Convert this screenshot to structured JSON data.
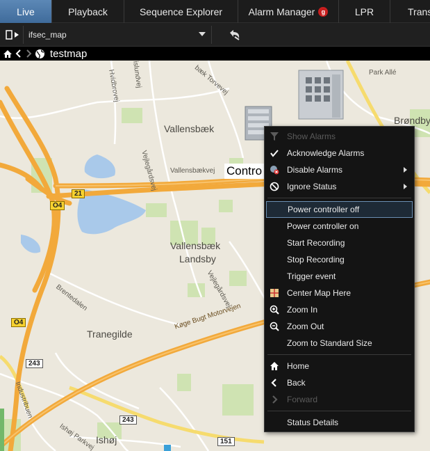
{
  "tabs": [
    {
      "label": "Live",
      "active": true
    },
    {
      "label": "Playback"
    },
    {
      "label": "Sequence Explorer"
    },
    {
      "label": "Alarm Manager",
      "badge": "g"
    },
    {
      "label": "LPR"
    },
    {
      "label": "Transa"
    }
  ],
  "toolbar": {
    "map_name": "ifsec_map"
  },
  "breadcrumb": {
    "title": "testmap"
  },
  "map": {
    "device_label": "Contro",
    "labels": {
      "park_alle": "Park Allé",
      "brondby": "Brøndby",
      "vallensbaek": "Vallensbæk",
      "vallensbaek_landsby_1": "Vallensbæk",
      "vallensbaek_landsby_2": "Landsby",
      "tranegilde": "Tranegilde",
      "ishoj": "Ishøj",
      "vallensbaekvej": "Vallensbækvej",
      "vejlegardsvej": "Vejlegårdsvej",
      "vejlegardsvej_2": "Vejlegårdsvej",
      "hvidbrovej": "Hvidbrovej",
      "islundvej": "islundvej",
      "torvevej": "bæk Torvevej",
      "brentedalen": "Brentedalen",
      "koge_bugt": "Køge Bugt Motorvejen",
      "industribuen": "Industribuen",
      "ishoj_parkvej": "Ishøj Parkvej"
    },
    "shields": {
      "r21": "21",
      "o4a": "O4",
      "o4b": "O4",
      "r243a": "243",
      "r243b": "243",
      "r151": "151"
    }
  },
  "context_menu": {
    "show_alarms": "Show Alarms",
    "acknowledge_alarms": "Acknowledge Alarms",
    "disable_alarms": "Disable Alarms",
    "ignore_status": "Ignore Status",
    "power_off": "Power controller off",
    "power_on": "Power controller on",
    "start_recording": "Start Recording",
    "stop_recording": "Stop Recording",
    "trigger_event": "Trigger event",
    "center_map": "Center Map Here",
    "zoom_in": "Zoom In",
    "zoom_out": "Zoom Out",
    "zoom_standard": "Zoom to Standard Size",
    "home": "Home",
    "back": "Back",
    "forward": "Forward",
    "status_details": "Status Details"
  },
  "colors": {
    "active_tab": "#4f7cab",
    "highway": "#f2a93b",
    "road_yellow": "#f9e27a",
    "water": "#a7c8e8",
    "park": "#c8e0a8",
    "map_bg": "#ece8dd"
  }
}
